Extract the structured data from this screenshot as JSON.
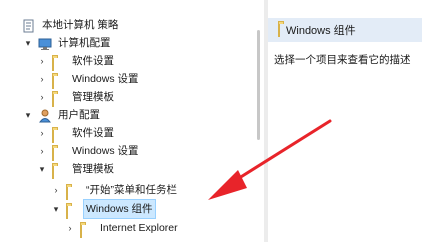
{
  "tree": {
    "root_label": "本地计算机 策略",
    "computer_config": {
      "label": "计算机配置",
      "children": [
        "软件设置",
        "Windows 设置",
        "管理模板"
      ]
    },
    "user_config": {
      "label": "用户配置",
      "children": [
        "软件设置",
        "Windows 设置",
        "管理模板"
      ],
      "admin_templates_children": [
        "“开始”菜单和任务栏",
        "Windows 组件"
      ],
      "windows_components_children": [
        "Internet Explorer"
      ]
    }
  },
  "detail": {
    "header_title": "Windows 组件",
    "description": "选择一个项目来查看它的描述"
  },
  "colors": {
    "selection": "#cce8ff",
    "arrow": "#e8242a",
    "header_bg": "#e3ecf7"
  }
}
